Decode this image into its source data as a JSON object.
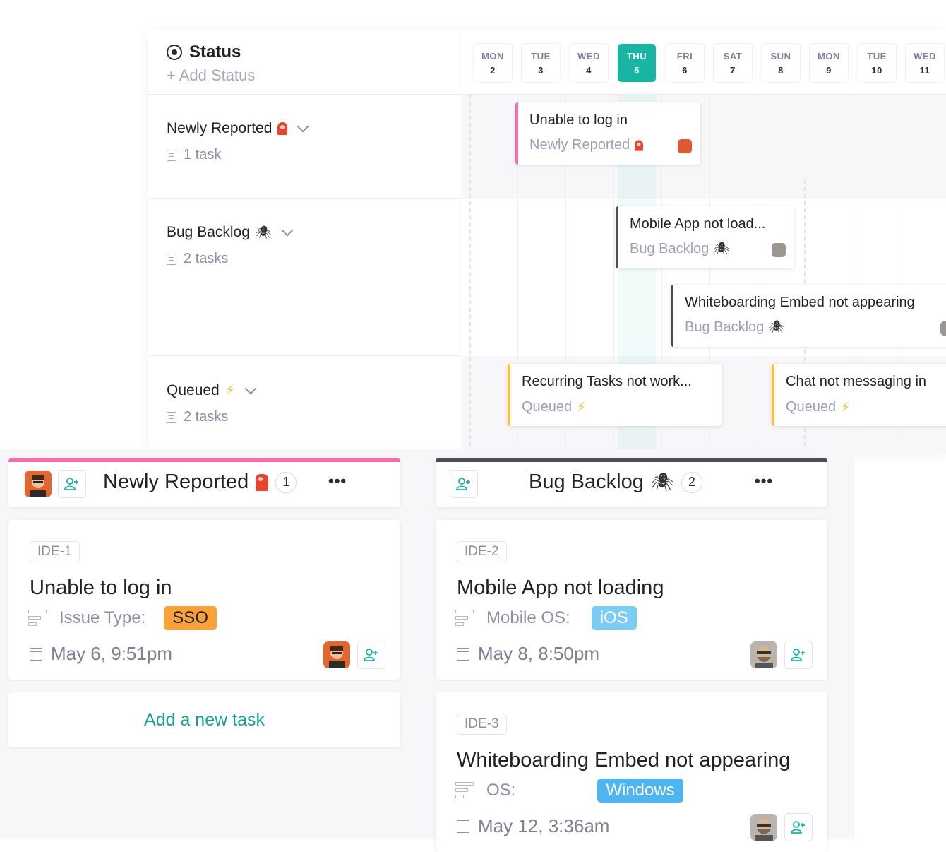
{
  "status_panel": {
    "title": "Status",
    "add_label": "+ Add Status",
    "groups": [
      {
        "name": "Newly Reported",
        "icon": "alarm-icon",
        "count": "1 task"
      },
      {
        "name": "Bug Backlog",
        "icon": "spider-icon",
        "count": "2 tasks"
      },
      {
        "name": "Queued",
        "icon": "bolt-icon",
        "count": "2 tasks"
      }
    ]
  },
  "days": [
    {
      "name": "MON",
      "num": "2"
    },
    {
      "name": "TUE",
      "num": "3"
    },
    {
      "name": "WED",
      "num": "4"
    },
    {
      "name": "THU",
      "num": "5",
      "today": true
    },
    {
      "name": "FRI",
      "num": "6"
    },
    {
      "name": "SAT",
      "num": "7"
    },
    {
      "name": "SUN",
      "num": "8"
    },
    {
      "name": "MON",
      "num": "9"
    },
    {
      "name": "TUE",
      "num": "10"
    },
    {
      "name": "WED",
      "num": "11"
    }
  ],
  "timeline_cards": [
    {
      "title": "Unable to log in",
      "status": "Newly Reported"
    },
    {
      "title": "Mobile App not load...",
      "status": "Bug Backlog"
    },
    {
      "title": "Whiteboarding Embed not appearing",
      "status": "Bug Backlog"
    },
    {
      "title": "Recurring Tasks not work...",
      "status": "Queued"
    },
    {
      "title": "Chat not messaging in",
      "status": "Queued"
    }
  ],
  "board": {
    "columns": [
      {
        "title": "Newly Reported",
        "count": "1",
        "accent": "#f56cb0",
        "cards": [
          {
            "id": "IDE-1",
            "title": "Unable to log in",
            "field_label": "Issue Type:",
            "tag": "SSO",
            "tag_color": "#f9a23b",
            "date": "May 6, 9:51pm"
          }
        ],
        "add_label": "Add a new task"
      },
      {
        "title": "Bug Backlog",
        "count": "2",
        "accent": "#4a4d55",
        "cards": [
          {
            "id": "IDE-2",
            "title": "Mobile App not loading",
            "field_label": "Mobile OS:",
            "tag": "iOS",
            "tag_color": "#7ccdf3",
            "date": "May 8, 8:50pm"
          },
          {
            "id": "IDE-3",
            "title": "Whiteboarding Embed not appearing",
            "field_label": "OS:",
            "tag": "Windows",
            "tag_color": "#4db5f0",
            "date": "May 12, 3:36am"
          }
        ]
      }
    ]
  },
  "colors": {
    "accent": "#18b5a4",
    "pink": "#f56cb0",
    "yellow": "#f6c23b"
  }
}
